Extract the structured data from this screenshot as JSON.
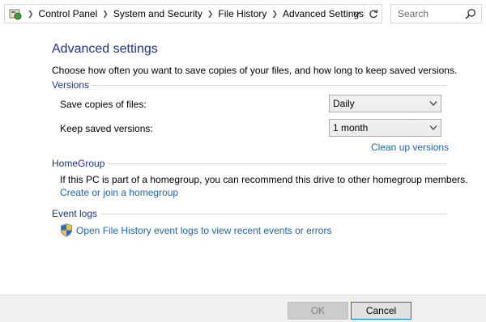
{
  "breadcrumb": {
    "items": [
      "Control Panel",
      "System and Security",
      "File History",
      "Advanced Settings"
    ]
  },
  "search": {
    "placeholder": "Search"
  },
  "page": {
    "title": "Advanced settings",
    "subtitle": "Choose how often you want to save copies of your files, and how long to keep saved versions."
  },
  "versions": {
    "heading": "Versions",
    "save_label": "Save copies of files:",
    "save_value": "Daily",
    "keep_label": "Keep saved versions:",
    "keep_value": "1 month",
    "cleanup_link": "Clean up versions"
  },
  "homegroup": {
    "heading": "HomeGroup",
    "text": "If this PC is part of a homegroup, you can recommend this drive to other homegroup members.",
    "link": "Create or join a homegroup"
  },
  "event_logs": {
    "heading": "Event logs",
    "link": "Open File History event logs to view recent events or errors"
  },
  "footer": {
    "ok_label": "OK",
    "cancel_label": "Cancel"
  },
  "colors": {
    "heading_blue": "#1e3287",
    "link_blue": "#1e64b4",
    "focus_blue": "#0078d7"
  },
  "icons": {
    "address": "control-panel-icon",
    "refresh": "refresh-icon",
    "search": "search-icon",
    "dropdown": "chevron-down-icon",
    "uac": "shield-icon"
  }
}
